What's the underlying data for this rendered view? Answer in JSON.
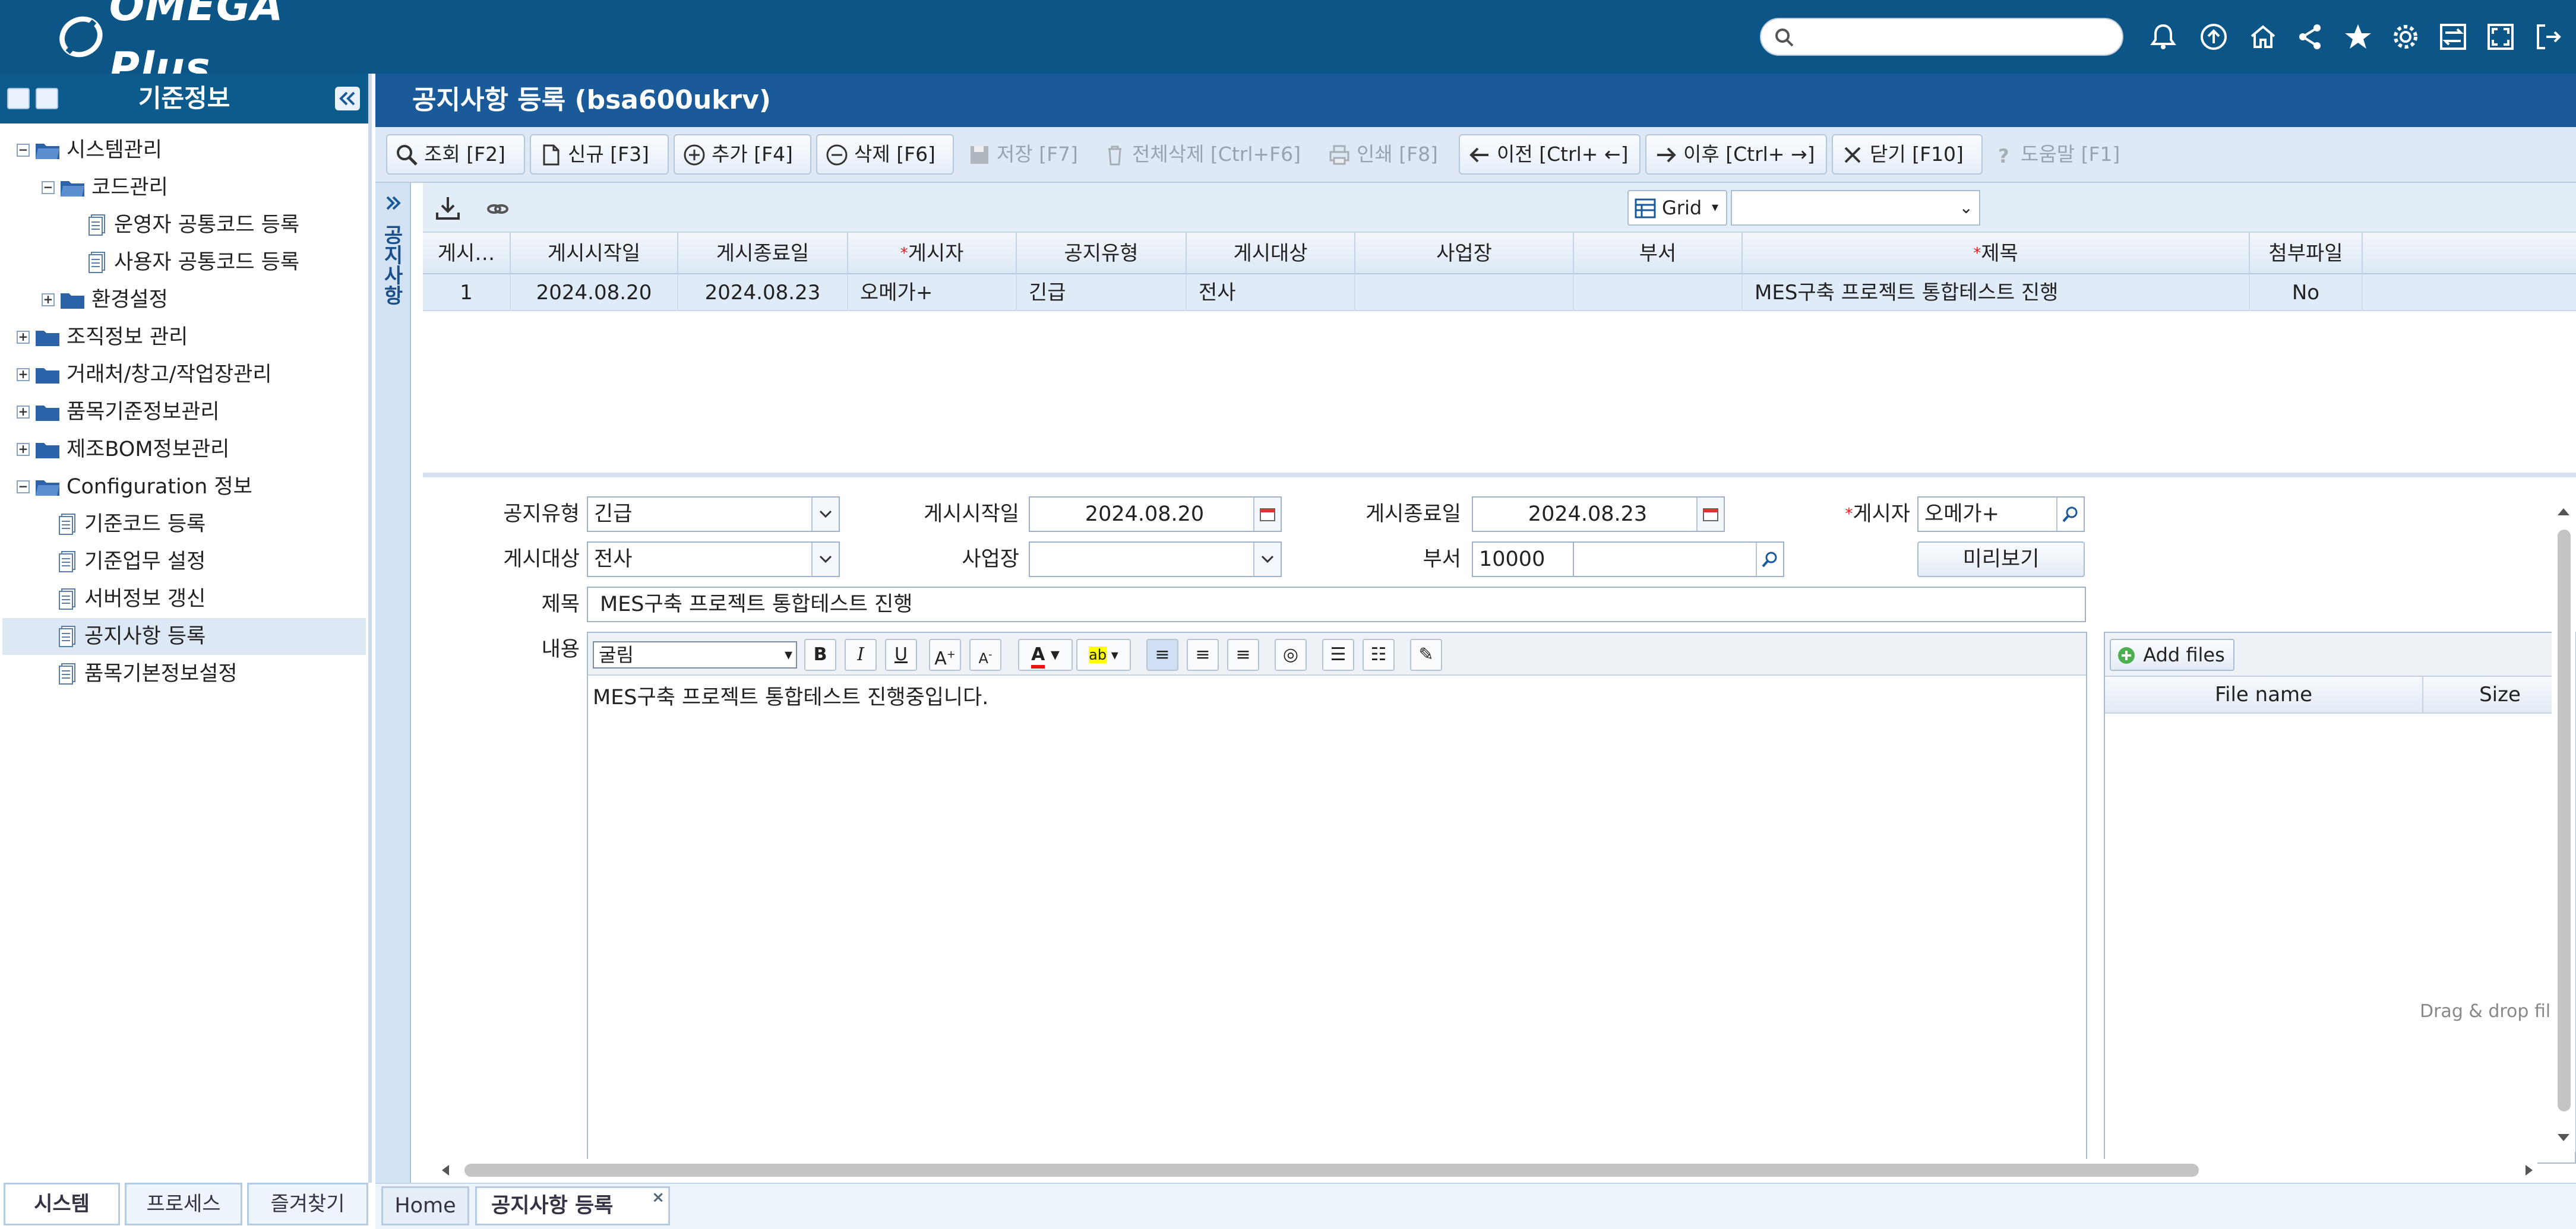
{
  "app": {
    "logo_text": "OMEGA Plus",
    "search_placeholder": ""
  },
  "colors": {
    "topbar": "#0c5587",
    "header": "#1a5a98",
    "required": "#e02020",
    "selected_row": "#e0ebf8"
  },
  "top_icons": [
    "bell-icon",
    "upload-icon",
    "home-icon",
    "share-icon",
    "star-icon",
    "gear-icon",
    "swap-icon",
    "fullscreen-icon",
    "logout-icon"
  ],
  "sidebar": {
    "title": "기준정보",
    "tree": [
      {
        "label": "시스템관리",
        "type": "folder",
        "expanded": true
      },
      {
        "label": "코드관리",
        "type": "folder",
        "expanded": true
      },
      {
        "label": "운영자 공통코드 등록",
        "type": "doc"
      },
      {
        "label": "사용자 공통코드 등록",
        "type": "doc"
      },
      {
        "label": "환경설정",
        "type": "folder",
        "expanded": false
      },
      {
        "label": "조직정보 관리",
        "type": "folder",
        "expanded": false
      },
      {
        "label": "거래처/창고/작업장관리",
        "type": "folder",
        "expanded": false
      },
      {
        "label": "품목기준정보관리",
        "type": "folder",
        "expanded": false
      },
      {
        "label": "제조BOM정보관리",
        "type": "folder",
        "expanded": false
      },
      {
        "label": "Configuration 정보",
        "type": "folder",
        "expanded": true
      },
      {
        "label": "기준코드 등록",
        "type": "doc"
      },
      {
        "label": "기준업무 설정",
        "type": "doc"
      },
      {
        "label": "서버정보 갱신",
        "type": "doc"
      },
      {
        "label": "공지사항 등록",
        "type": "doc",
        "selected": true
      },
      {
        "label": "품목기본정보설정",
        "type": "doc"
      }
    ],
    "bottom_tabs": [
      "시스템",
      "프로세스",
      "즐겨찾기"
    ]
  },
  "page": {
    "title": "공지사항 등록 (bsa600ukrv)"
  },
  "toolbar": {
    "query": "조회 [F2]",
    "new": "신규 [F3]",
    "add": "추가 [F4]",
    "delete": "삭제 [F6]",
    "save": "저장 [F7]",
    "delete_all": "전체삭제 [Ctrl+F6]",
    "print": "인쇄 [F8]",
    "prev": "이전 [Ctrl+ ←]",
    "next": "이후 [Ctrl+ →]",
    "close": "닫기 [F10]",
    "help": "도움말 [F1]"
  },
  "side_strip": {
    "label": "공지사항"
  },
  "grid": {
    "view_label": "Grid",
    "columns": [
      "게시…",
      "게시시작일",
      "게시종료일",
      "게시자",
      "공지유형",
      "게시대상",
      "사업장",
      "부서",
      "제목",
      "첨부파일"
    ],
    "rows": [
      [
        "1",
        "2024.08.20",
        "2024.08.23",
        "오메가+",
        "긴급",
        "전사",
        "",
        "",
        "MES구축 프로젝트 통합테스트 진행",
        "No"
      ]
    ]
  },
  "form": {
    "notice_type_label": "공지유형",
    "notice_type_value": "긴급",
    "start_date_label": "게시시작일",
    "start_date_value": "2024.08.20",
    "end_date_label": "게시종료일",
    "end_date_value": "2024.08.23",
    "poster_label": "게시자",
    "poster_value": "오메가+",
    "target_label": "게시대상",
    "target_value": "전사",
    "site_label": "사업장",
    "site_value": "",
    "dept_label": "부서",
    "dept_value": "10000",
    "preview_button": "미리보기",
    "subject_label": "제목",
    "subject_value": "MES구축 프로젝트 통합테스트 진행",
    "content_label": "내용",
    "editor_font": "굴림",
    "content_value": "MES구축 프로젝트 통합테스트 진행중입니다."
  },
  "files": {
    "add_button": "Add files",
    "col_name": "File name",
    "col_size": "Size",
    "drop_hint": "Drag & drop fil"
  },
  "bottom_tabs": {
    "home": "Home",
    "current": "공지사항 등록"
  }
}
